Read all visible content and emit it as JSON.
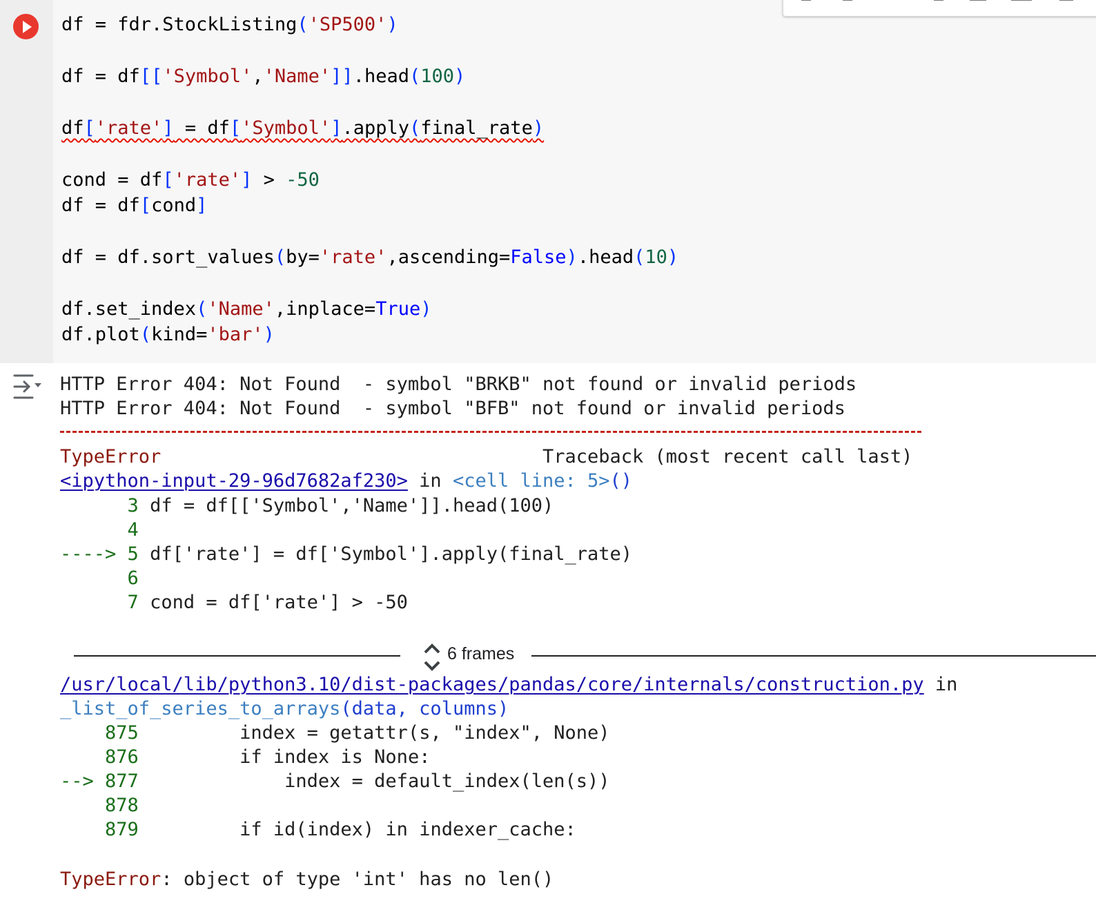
{
  "code_cell": {
    "lines": [
      [
        "df = fdr.StockListing",
        "(",
        "'SP500'",
        ")"
      ],
      [
        "df = df",
        "[[",
        "'Symbol'",
        ",",
        "'Name'",
        "]]",
        ".head",
        "(",
        "100",
        ")"
      ],
      [
        "df",
        "[",
        "'rate'",
        "]",
        " = df",
        "[",
        "'Symbol'",
        "]",
        ".apply",
        "(",
        "final_rate",
        ")"
      ],
      [
        "cond = df",
        "[",
        "'rate'",
        "]",
        " > ",
        "-50"
      ],
      [
        "df = df",
        "[",
        "cond",
        "]"
      ],
      [
        "df = df.sort_values",
        "(",
        "by=",
        "'rate'",
        ",ascending=",
        "False",
        ")",
        ".head",
        "(",
        "10",
        ")"
      ],
      [
        "df.set_index",
        "(",
        "'Name'",
        ",inplace=",
        "True",
        ")"
      ],
      [
        "df.plot",
        "(",
        "kind=",
        "'bar'",
        ")"
      ]
    ]
  },
  "output": {
    "http_errors": [
      "HTTP Error 404: Not Found  - symbol \"BRKB\" not found or invalid periods",
      "HTTP Error 404: Not Found  - symbol \"BFB\" not found or invalid periods"
    ],
    "error_type": "TypeError",
    "traceback_header": "Traceback (most recent call last)",
    "input_link": "<ipython-input-29-96d7682af230>",
    "in_word": " in ",
    "cell_ref": "<cell line: 5>",
    "cell_ref_parens": "()",
    "context1": [
      {
        "prefix": "      ",
        "num": "3",
        "code": " df = df[['Symbol','Name']].head(100)"
      },
      {
        "prefix": "      ",
        "num": "4",
        "code": ""
      },
      {
        "prefix": "----> ",
        "num": "5",
        "code": " df['rate'] = df['Symbol'].apply(final_rate)"
      },
      {
        "prefix": "      ",
        "num": "6",
        "code": ""
      },
      {
        "prefix": "      ",
        "num": "7",
        "code": " cond = df['rate'] > -50"
      }
    ],
    "frames_label": "6 frames",
    "file_link": "/usr/local/lib/python3.10/dist-packages/pandas/core/internals/construction.py",
    "func_name": "_list_of_series_to_arrays",
    "func_args": "(data, columns)",
    "context2": [
      {
        "prefix": "    ",
        "num": "875",
        "code": "         index = getattr(s, \"index\", None)"
      },
      {
        "prefix": "    ",
        "num": "876",
        "code": "         if index is None:"
      },
      {
        "prefix": "--> ",
        "num": "877",
        "code": "             index = default_index(len(s))"
      },
      {
        "prefix": "    ",
        "num": "878",
        "code": ""
      },
      {
        "prefix": "    ",
        "num": "879",
        "code": "         if id(index) in indexer_cache:"
      }
    ],
    "final_error_message": ": object of type 'int' has no len()"
  }
}
